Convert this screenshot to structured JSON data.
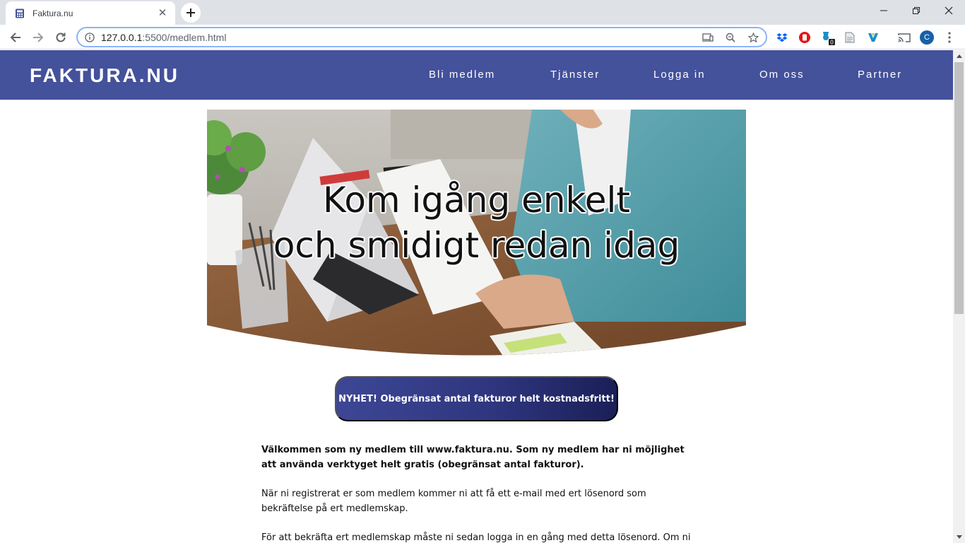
{
  "browser": {
    "tab_title": "Faktura.nu",
    "url_host": "127.0.0.1",
    "url_path": ":5500/medlem.html",
    "extension_badge": "0",
    "profile_initial": "C"
  },
  "site": {
    "logo": "FAKTURA.NU",
    "nav": [
      "Bli medlem",
      "Tjänster",
      "Logga in",
      "Om oss",
      "Partner"
    ]
  },
  "hero": {
    "line1": "Kom igång enkelt",
    "line2": "och smidigt redan idag"
  },
  "promo": {
    "label": "NYHET! Obegränsat antal fakturor helt kostnadsfritt!"
  },
  "content": {
    "lead": "Välkommen som ny medlem till www.faktura.nu. Som ny medlem har ni möjlighet att använda verktyget helt gratis (obegränsat antal fakturor).",
    "para2": "När ni registrerat er som medlem kommer ni att få ett e-mail med ert lösenord som bekräftelse på ert medlemskap.",
    "para3": "För att bekräfta ert medlemskap måste ni sedan logga in en gång med detta lösenord. Om ni"
  },
  "colors": {
    "header_bg": "#44519b",
    "promo_start": "#3d4795",
    "promo_end": "#1a1f57"
  }
}
